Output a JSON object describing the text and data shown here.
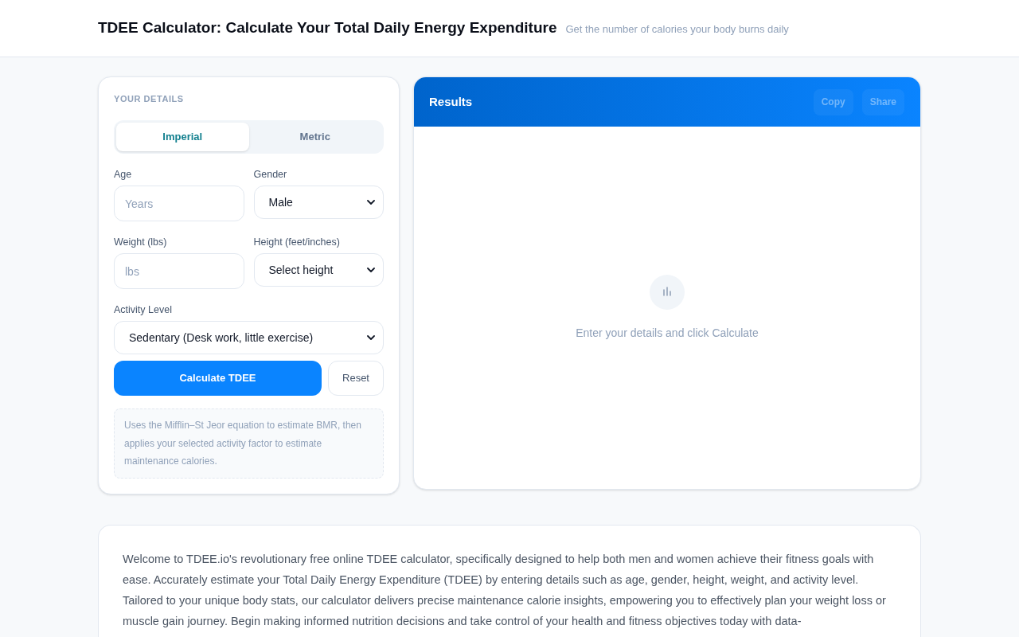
{
  "header": {
    "title": "TDEE Calculator: Calculate Your Total Daily Energy Expenditure",
    "subtitle": "Get the number of calories your body burns daily"
  },
  "details_panel": {
    "heading": "YOUR DETAILS",
    "unit_tabs": [
      {
        "label": "Imperial",
        "selected": true
      },
      {
        "label": "Metric",
        "selected": false
      }
    ],
    "fields": [
      {
        "kind": "input",
        "label": "Age",
        "placeholder": "Years"
      },
      {
        "kind": "select",
        "label": "Gender",
        "value": "Male"
      },
      {
        "kind": "input",
        "label": "Weight (lbs)",
        "placeholder": "lbs"
      },
      {
        "kind": "select",
        "label": "Height (feet/inches)",
        "value": "Select height"
      }
    ],
    "activity_level": {
      "label": "Activity Level",
      "value": "Sedentary (Desk work, little exercise)"
    },
    "buttons": [
      {
        "kind": "primary",
        "label": "Calculate TDEE"
      },
      {
        "kind": "secondary",
        "label": "Reset"
      }
    ],
    "note": "Uses the Mifflin–St Jeor equation to estimate BMR, then applies your selected activity factor to estimate maintenance calories."
  },
  "results_panel": {
    "title": "Results",
    "actions": [
      {
        "label": "Copy",
        "disabled": true
      },
      {
        "label": "Share",
        "disabled": true
      }
    ],
    "empty_message": "Enter your details and click Calculate"
  },
  "intro": {
    "text": "Welcome to TDEE.io's revolutionary free online TDEE calculator, specifically designed to help both men and women achieve their fitness goals with ease. Accurately estimate your Total Daily Energy Expenditure (TDEE) by entering details such as age, gender, height, weight, and activity level. Tailored to your unique body stats, our calculator delivers precise maintenance calorie insights, empowering you to effectively plan your weight loss or muscle gain journey. Begin making informed nutrition decisions and take control of your health and fitness objectives today with data-"
  }
}
